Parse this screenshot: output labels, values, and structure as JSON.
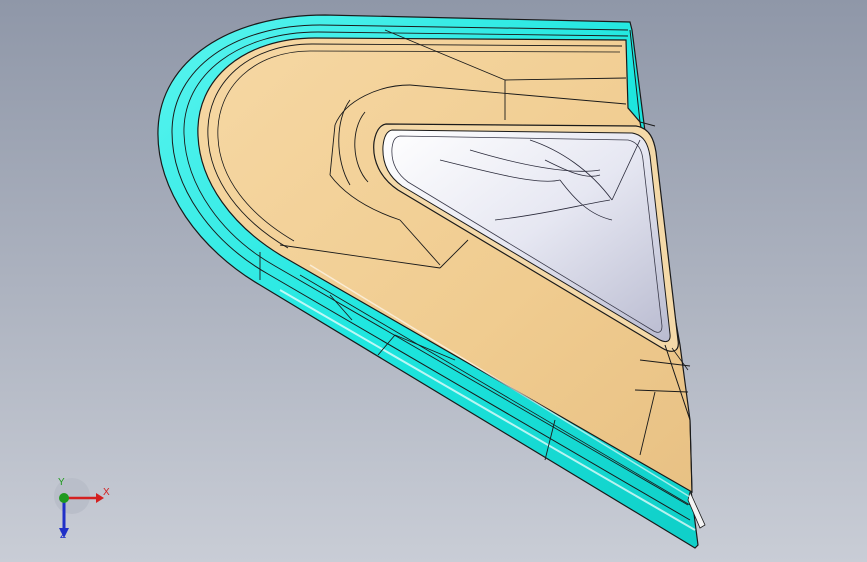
{
  "viewport": {
    "background_top": "#8f97a8",
    "background_bottom": "#c9cdd6"
  },
  "model": {
    "outer_flange_color": "#2ee8e0",
    "body_color": "#f2cf94",
    "pocket_color": "#dfe0ec",
    "edge_color": "#1a1a1a"
  },
  "triad": {
    "x_label": "X",
    "y_label": "Y",
    "z_label": "Z",
    "x_color": "#d42020",
    "y_color": "#1f9a1f",
    "z_color": "#2030c8"
  }
}
